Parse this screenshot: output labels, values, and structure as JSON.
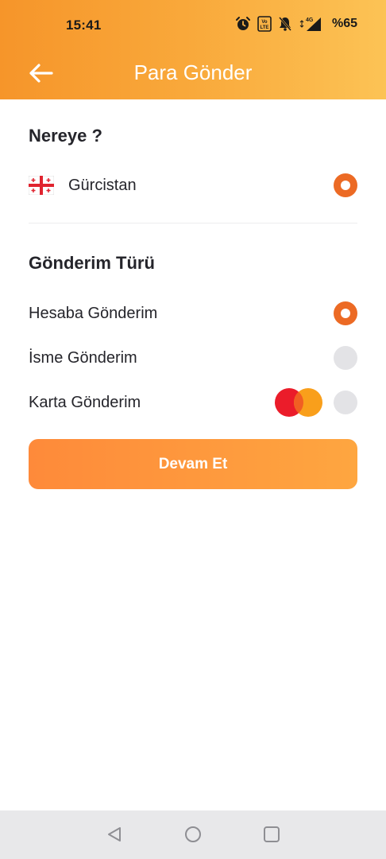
{
  "status_bar": {
    "time": "15:41",
    "network": "4G",
    "volte": "Vo LTE",
    "battery": "%65"
  },
  "header": {
    "title": "Para Gönder"
  },
  "destination": {
    "title": "Nereye ?",
    "country": {
      "name": "Gürcistan",
      "flag": "georgia-flag",
      "selected": true
    }
  },
  "transfer_type": {
    "title": "Gönderim Türü",
    "options": [
      {
        "label": "Hesaba Gönderim",
        "selected": true
      },
      {
        "label": "İsme Gönderim",
        "selected": false
      },
      {
        "label": "Karta Gönderim",
        "selected": false,
        "icon": "mastercard-icon"
      }
    ]
  },
  "actions": {
    "continue_label": "Devam Et"
  },
  "colors": {
    "accent": "#ec6a24",
    "header_start": "#f6952a",
    "header_end": "#fcc355",
    "button_start": "#fe8a3a",
    "button_end": "#fea640"
  }
}
